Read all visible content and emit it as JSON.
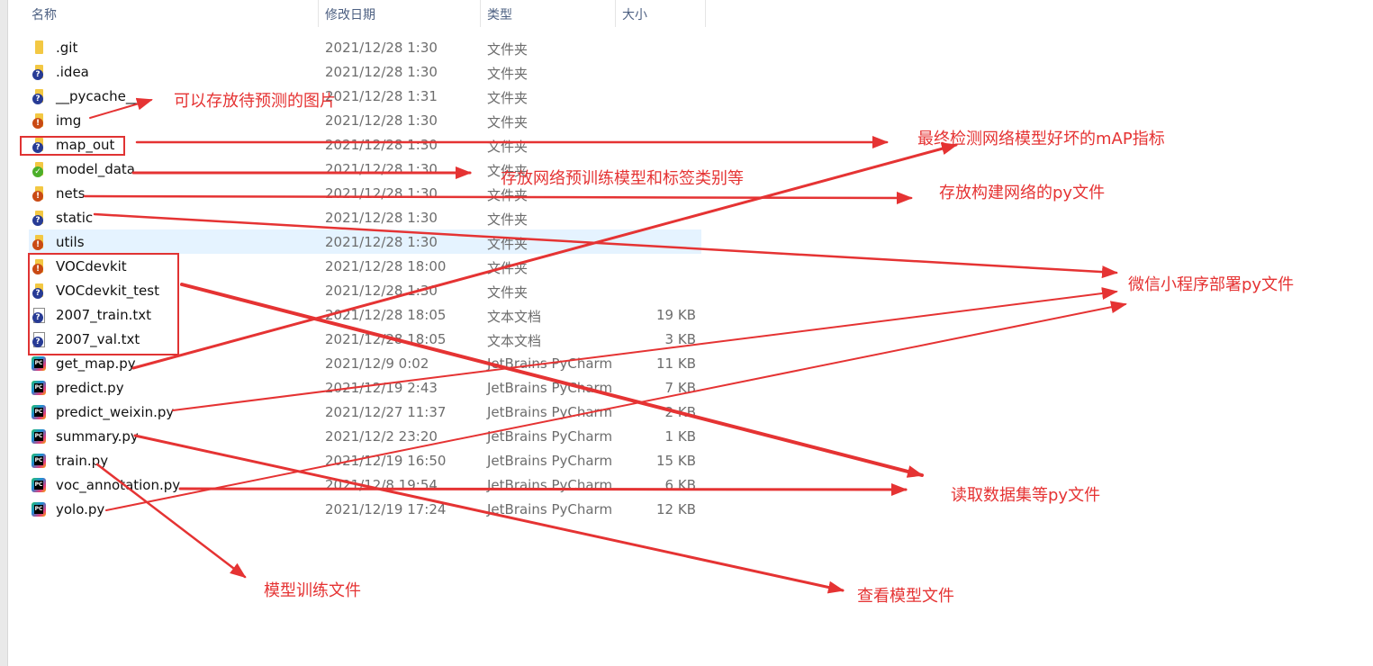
{
  "columns": {
    "name": "名称",
    "date": "修改日期",
    "type": "类型",
    "size": "大小"
  },
  "header_mark": "^",
  "files": [
    {
      "name": ".git",
      "date": "2021/12/28 1:30",
      "type": "文件夹",
      "size": "",
      "icon": "folder-icon",
      "overlay": ""
    },
    {
      "name": ".idea",
      "date": "2021/12/28 1:30",
      "type": "文件夹",
      "size": "",
      "icon": "folder-icon",
      "overlay": "?"
    },
    {
      "name": "__pycache__",
      "date": "2021/12/28 1:31",
      "type": "文件夹",
      "size": "",
      "icon": "folder-icon",
      "overlay": "?"
    },
    {
      "name": "img",
      "date": "2021/12/28 1:30",
      "type": "文件夹",
      "size": "",
      "icon": "folder-icon",
      "overlay": "!"
    },
    {
      "name": "map_out",
      "date": "2021/12/28 1:30",
      "type": "文件夹",
      "size": "",
      "icon": "folder-icon",
      "overlay": "?"
    },
    {
      "name": "model_data",
      "date": "2021/12/28 1:30",
      "type": "文件夹",
      "size": "",
      "icon": "folder-icon",
      "overlay": "✓"
    },
    {
      "name": "nets",
      "date": "2021/12/28 1:30",
      "type": "文件夹",
      "size": "",
      "icon": "folder-icon",
      "overlay": "!"
    },
    {
      "name": "static",
      "date": "2021/12/28 1:30",
      "type": "文件夹",
      "size": "",
      "icon": "folder-icon",
      "overlay": "?"
    },
    {
      "name": "utils",
      "date": "2021/12/28 1:30",
      "type": "文件夹",
      "size": "",
      "icon": "folder-icon",
      "overlay": "!"
    },
    {
      "name": "VOCdevkit",
      "date": "2021/12/28 18:00",
      "type": "文件夹",
      "size": "",
      "icon": "folder-icon",
      "overlay": "!"
    },
    {
      "name": "VOCdevkit_test",
      "date": "2021/12/28 1:30",
      "type": "文件夹",
      "size": "",
      "icon": "folder-icon",
      "overlay": "?"
    },
    {
      "name": "2007_train.txt",
      "date": "2021/12/28 18:05",
      "type": "文本文档",
      "size": "19 KB",
      "icon": "text-file-icon",
      "overlay": "?"
    },
    {
      "name": "2007_val.txt",
      "date": "2021/12/28 18:05",
      "type": "文本文档",
      "size": "3 KB",
      "icon": "text-file-icon",
      "overlay": "?"
    },
    {
      "name": "get_map.py",
      "date": "2021/12/9 0:02",
      "type": "JetBrains PyCharm",
      "size": "11 KB",
      "icon": "pycharm-file-icon",
      "overlay": ""
    },
    {
      "name": "predict.py",
      "date": "2021/12/19 2:43",
      "type": "JetBrains PyCharm",
      "size": "7 KB",
      "icon": "pycharm-file-icon",
      "overlay": ""
    },
    {
      "name": "predict_weixin.py",
      "date": "2021/12/27 11:37",
      "type": "JetBrains PyCharm",
      "size": "2 KB",
      "icon": "pycharm-file-icon",
      "overlay": ""
    },
    {
      "name": "summary.py",
      "date": "2021/12/2 23:20",
      "type": "JetBrains PyCharm",
      "size": "1 KB",
      "icon": "pycharm-file-icon",
      "overlay": ""
    },
    {
      "name": "train.py",
      "date": "2021/12/19 16:50",
      "type": "JetBrains PyCharm",
      "size": "15 KB",
      "icon": "pycharm-file-icon",
      "overlay": ""
    },
    {
      "name": "voc_annotation.py",
      "date": "2021/12/8 19:54",
      "type": "JetBrains PyCharm",
      "size": "6 KB",
      "icon": "pycharm-file-icon",
      "overlay": ""
    },
    {
      "name": "yolo.py",
      "date": "2021/12/19 17:24",
      "type": "JetBrains PyCharm",
      "size": "12 KB",
      "icon": "pycharm-file-icon",
      "overlay": ""
    }
  ],
  "selected_row": "utils",
  "annotations": [
    "可以存放待预测的图片",
    "最终检测网络模型好坏的mAP指标",
    "存放网络预训练模型和标签类别等",
    "存放构建网络的py文件",
    "微信小程序部署py文件",
    "读取数据集等py文件",
    "模型训练文件",
    "查看模型文件"
  ],
  "colors": {
    "annotation": "#e53333",
    "selection": "#e5f3ff",
    "header_text": "#4d6082",
    "folder": "#f3c843"
  }
}
